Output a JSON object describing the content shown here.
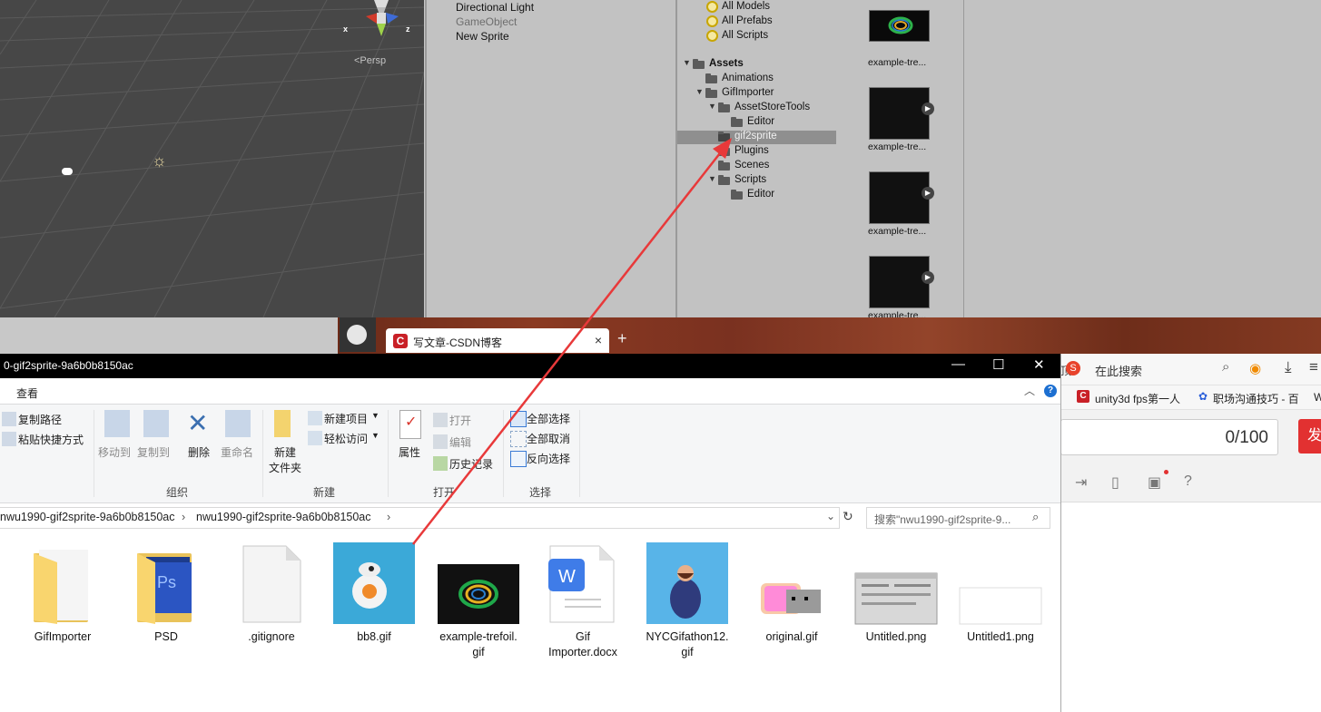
{
  "unity": {
    "scene": {
      "persp_label": "<Persp",
      "axis_x": "x",
      "axis_z": "z"
    },
    "hierarchy": [
      "Directional Light",
      "GameObject",
      "New Sprite"
    ],
    "favorites": [
      "All Models",
      "All Prefabs",
      "All Scripts"
    ],
    "assets_tree": [
      {
        "label": "Assets",
        "depth": 0,
        "expanded": true
      },
      {
        "label": "Animations",
        "depth": 1,
        "expanded": false
      },
      {
        "label": "GifImporter",
        "depth": 1,
        "expanded": true
      },
      {
        "label": "AssetStoreTools",
        "depth": 2,
        "expanded": true
      },
      {
        "label": "Editor",
        "depth": 3,
        "expanded": false
      },
      {
        "label": "gif2sprite",
        "depth": 2,
        "expanded": false,
        "selected": true
      },
      {
        "label": "Plugins",
        "depth": 2,
        "expanded": false
      },
      {
        "label": "Scenes",
        "depth": 2,
        "expanded": false
      },
      {
        "label": "Scripts",
        "depth": 2,
        "expanded": true
      },
      {
        "label": "Editor",
        "depth": 3,
        "expanded": false
      }
    ],
    "asset_labels": [
      "example-tre...",
      "example-tre...",
      "example-tre...",
      "example-tre..."
    ]
  },
  "browser_tab": {
    "title": "写文章-CSDN博客",
    "close": "×",
    "new_tab": "+"
  },
  "browser_right": {
    "search_placeholder": "在此搜索",
    "bookmarks": [
      "unity3d fps第一人",
      "职场沟通技巧 - 百"
    ],
    "counter": "0/100",
    "publish_fragment": "发",
    "cut_fragment": "顶",
    "cut_fragment2": "W"
  },
  "explorer": {
    "title": "0-gif2sprite-9a6b0b8150ac",
    "ribbon_tab": "查看",
    "clipboard": {
      "copy_path": "复制路径",
      "paste_shortcut": "粘贴快捷方式"
    },
    "organize": {
      "move_to": "移动到",
      "copy_to": "复制到",
      "delete": "删除",
      "rename": "重命名",
      "label": "组织"
    },
    "new": {
      "new_folder_1": "新建",
      "new_folder_2": "文件夹",
      "new_item": "新建项目",
      "easy_access": "轻松访问",
      "label": "新建"
    },
    "open": {
      "properties": "属性",
      "open": "打开",
      "edit": "编辑",
      "history": "历史记录",
      "label": "打开"
    },
    "select": {
      "select_all": "全部选择",
      "select_none": "全部取消",
      "invert": "反向选择",
      "label": "选择"
    },
    "address": [
      "nwu1990-gif2sprite-9a6b0b8150ac",
      "nwu1990-gif2sprite-9a6b0b8150ac"
    ],
    "search_placeholder": "搜索\"nwu1990-gif2sprite-9...",
    "files": [
      {
        "name": "GifImporter",
        "type": "folder"
      },
      {
        "name": "PSD",
        "type": "folder-ps"
      },
      {
        "name": ".gitignore",
        "type": "blank"
      },
      {
        "name": "bb8.gif",
        "type": "image-bb8"
      },
      {
        "name": "example-trefoil.\ngif",
        "type": "image-trefoil"
      },
      {
        "name": "Gif\nImporter.docx",
        "type": "docx"
      },
      {
        "name": "NYCGifathon12.\ngif",
        "type": "image-man"
      },
      {
        "name": "original.gif",
        "type": "image-nyan"
      },
      {
        "name": "Untitled.png",
        "type": "image-ui"
      },
      {
        "name": "Untitled1.png",
        "type": "image-white"
      }
    ]
  },
  "colors": {
    "arrow": "#e8393a",
    "unity_panel": "#c2c2c2",
    "scene_bg": "#474747",
    "csdn_red": "#c92027"
  }
}
